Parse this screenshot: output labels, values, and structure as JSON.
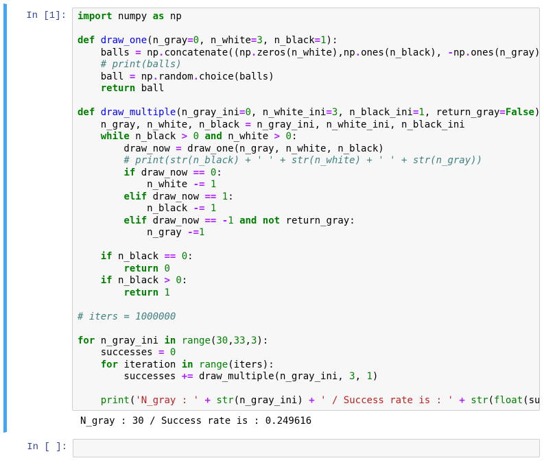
{
  "cells": [
    {
      "prompt": "In [1]:",
      "output": "N_gray : 30 / Success rate is : 0.249616"
    },
    {
      "prompt": "In [ ]:"
    }
  ],
  "code": {
    "l1": {
      "import": "import",
      "numpy": "numpy",
      "as": "as",
      "np": "np"
    },
    "l2": {
      "def": "def",
      "name": "draw_one",
      "p1": "(n_gray",
      "eq1": "=",
      "v1": "0",
      "p2": ", n_white",
      "eq2": "=",
      "v2": "3",
      "p3": ", n_black",
      "eq3": "=",
      "v3": "1",
      "close": "):"
    },
    "l3": {
      "indent": "    balls ",
      "eq": "=",
      "rest": " np",
      "dot1": ".",
      "fn1": "concatenate((np",
      "dot2": ".",
      "fn2": "zeros(n_white),np",
      "dot3": ".",
      "fn3": "ones(n_black), ",
      "neg": "-",
      "np4": "np",
      "dot4": ".",
      "fn4": "ones(n_gray)))"
    },
    "l4": {
      "cmt": "    # print(balls)"
    },
    "l5": {
      "indent": "    ball ",
      "eq": "=",
      "rest": " np",
      "dot": ".",
      "r1": "random",
      "dot2": ".",
      "r2": "choice(balls)"
    },
    "l6": {
      "indent": "    ",
      "ret": "return",
      "rest": " ball"
    },
    "l7": {
      "def": "def",
      "name": "draw_multiple",
      "p1": "(n_gray_ini",
      "eq1": "=",
      "v1": "0",
      "p2": ", n_white_ini",
      "eq2": "=",
      "v2": "3",
      "p3": ", n_black_ini",
      "eq3": "=",
      "v3": "1",
      "p4": ", return_gray",
      "eq4": "=",
      "v4": "False",
      "close": "):"
    },
    "l8": {
      "indent": "    n_gray, n_white, n_black ",
      "eq": "=",
      "rest": " n_gray_ini, n_white_ini, n_black_ini"
    },
    "l9": {
      "indent": "    ",
      "while": "while",
      "r1": " n_black ",
      "gt1": ">",
      "sp1": " ",
      "z1": "0",
      "sp2": " ",
      "and": "and",
      "r2": " n_white ",
      "gt2": ">",
      "sp3": " ",
      "z2": "0",
      "col": ":"
    },
    "l10": {
      "indent": "        draw_now ",
      "eq": "=",
      "rest": " draw_one(n_gray, n_white, n_black)"
    },
    "l11": {
      "cmt": "        # print(str(n_black) + ' ' + str(n_white) + ' ' + str(n_gray))"
    },
    "l12": {
      "indent": "        ",
      "if": "if",
      "r": " draw_now ",
      "eq": "==",
      "sp": " ",
      "v": "0",
      "col": ":"
    },
    "l13": {
      "indent": "            n_white ",
      "op": "-=",
      "sp": " ",
      "v": "1"
    },
    "l14": {
      "indent": "        ",
      "elif": "elif",
      "r": " draw_now ",
      "eq": "==",
      "sp": " ",
      "v": "1",
      "col": ":"
    },
    "l15": {
      "indent": "            n_black ",
      "op": "-=",
      "sp": " ",
      "v": "1"
    },
    "l16": {
      "indent": "        ",
      "elif": "elif",
      "r": " draw_now ",
      "eq": "==",
      "sp": " ",
      "neg": "-",
      "v": "1",
      "sp2": " ",
      "and": "and",
      "sp3": " ",
      "not": "not",
      "rest": " return_gray:"
    },
    "l17": {
      "indent": "            n_gray ",
      "op": "-=",
      "v": "1"
    },
    "l18": {
      "indent": "    ",
      "if": "if",
      "r": " n_black ",
      "eq": "==",
      "sp": " ",
      "v": "0",
      "col": ":"
    },
    "l19": {
      "indent": "        ",
      "ret": "return",
      "sp": " ",
      "v": "0"
    },
    "l20": {
      "indent": "    ",
      "if": "if",
      "r": " n_black ",
      "gt": ">",
      "sp": " ",
      "v": "0",
      "col": ":"
    },
    "l21": {
      "indent": "        ",
      "ret": "return",
      "sp": " ",
      "v": "1"
    },
    "l22": {
      "cmt": "# iters = 1000000"
    },
    "l23": {
      "for": "for",
      "r1": " n_gray_ini ",
      "in": "in",
      "sp": " ",
      "range": "range",
      "op": "(",
      "v1": "30",
      "c1": ",",
      "v2": "33",
      "c2": ",",
      "v3": "3",
      "close": "):"
    },
    "l24": {
      "indent": "    successes ",
      "eq": "=",
      "sp": " ",
      "v": "0"
    },
    "l25": {
      "indent": "    ",
      "for": "for",
      "r1": " iteration ",
      "in": "in",
      "sp": " ",
      "range": "range",
      "rest": "(iters):"
    },
    "l26": {
      "indent": "        successes ",
      "op": "+=",
      "rest": " draw_multiple(n_gray_ini, ",
      "v1": "3",
      "c": ", ",
      "v2": "1",
      "close": ")"
    },
    "l27": {
      "indent": "    ",
      "print": "print",
      "op": "(",
      "s1": "'N_gray : '",
      "sp1": " ",
      "plus1": "+",
      "sp2": " ",
      "str1": "str",
      "r1": "(n_gray_ini) ",
      "plus2": "+",
      "sp3": " ",
      "s2": "' / Success rate is : '",
      "sp4": " ",
      "plus3": "+",
      "sp5": " ",
      "str2": "str",
      "op2": "(",
      "float": "float",
      "rest": "(succes"
    }
  }
}
